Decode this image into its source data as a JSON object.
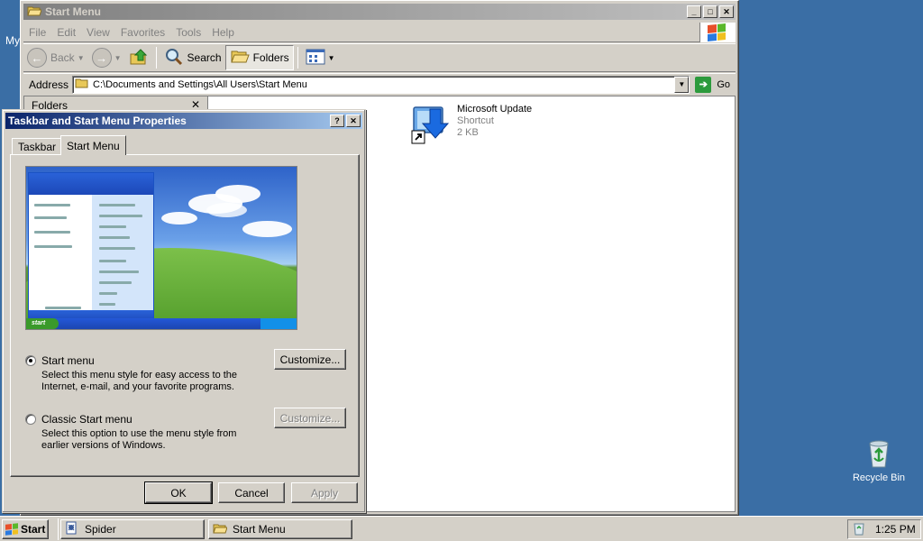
{
  "desktop": {
    "partial_label": "My",
    "recycle_bin": "Recycle Bin"
  },
  "explorer": {
    "title": "Start Menu",
    "menu": [
      "File",
      "Edit",
      "View",
      "Favorites",
      "Tools",
      "Help"
    ],
    "toolbar": {
      "back": "Back",
      "search": "Search",
      "folders": "Folders"
    },
    "address": {
      "label": "Address",
      "value": "C:\\Documents and Settings\\All Users\\Start Menu",
      "go": "Go"
    },
    "folders_pane": {
      "title": "Folders"
    },
    "file": {
      "name": "Microsoft Update",
      "type": "Shortcut",
      "size": "2 KB"
    }
  },
  "dialog": {
    "title": "Taskbar and Start Menu Properties",
    "tabs": [
      "Taskbar",
      "Start Menu"
    ],
    "active_tab": "Start Menu",
    "options": {
      "start_menu": {
        "label": "Start menu",
        "desc": "Select this menu style for easy access to the Internet, e-mail, and your favorite programs.",
        "selected": true
      },
      "classic": {
        "label": "Classic Start menu",
        "desc": "Select this option to use the menu style from earlier versions of Windows.",
        "selected": false
      }
    },
    "customize": "Customize...",
    "buttons": {
      "ok": "OK",
      "cancel": "Cancel",
      "apply": "Apply"
    }
  },
  "taskbar": {
    "start": "Start",
    "tasks": [
      "Spider",
      "Start Menu"
    ],
    "clock": "1:25 PM"
  }
}
